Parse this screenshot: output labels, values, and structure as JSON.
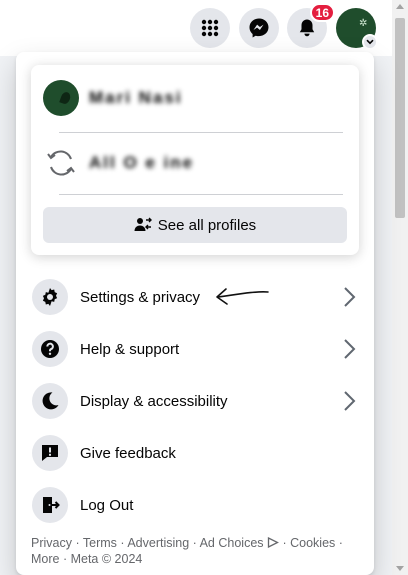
{
  "topbar": {
    "menu_icon": "grid-menu-icon",
    "messenger_icon": "messenger-icon",
    "notifications_icon": "bell-icon",
    "notification_count": "16",
    "account_chevron_icon": "chevron-down-icon"
  },
  "profiles": {
    "items": [
      {
        "name": "Mari   Nasi"
      },
      {
        "name": "All O   e   ine"
      }
    ],
    "see_all_label": "See all profiles"
  },
  "menu": {
    "items": [
      {
        "label": "Settings & privacy",
        "icon": "gear-icon"
      },
      {
        "label": "Help & support",
        "icon": "question-icon"
      },
      {
        "label": "Display & accessibility",
        "icon": "moon-icon"
      },
      {
        "label": "Give feedback",
        "icon": "feedback-icon"
      },
      {
        "label": "Log Out",
        "icon": "logout-icon"
      }
    ]
  },
  "footer": {
    "privacy": "Privacy",
    "terms": "Terms",
    "advertising": "Advertising",
    "ad_choices": "Ad Choices",
    "cookies": "Cookies",
    "more": "More",
    "copyright": "Meta © 2024",
    "sep": " · "
  }
}
